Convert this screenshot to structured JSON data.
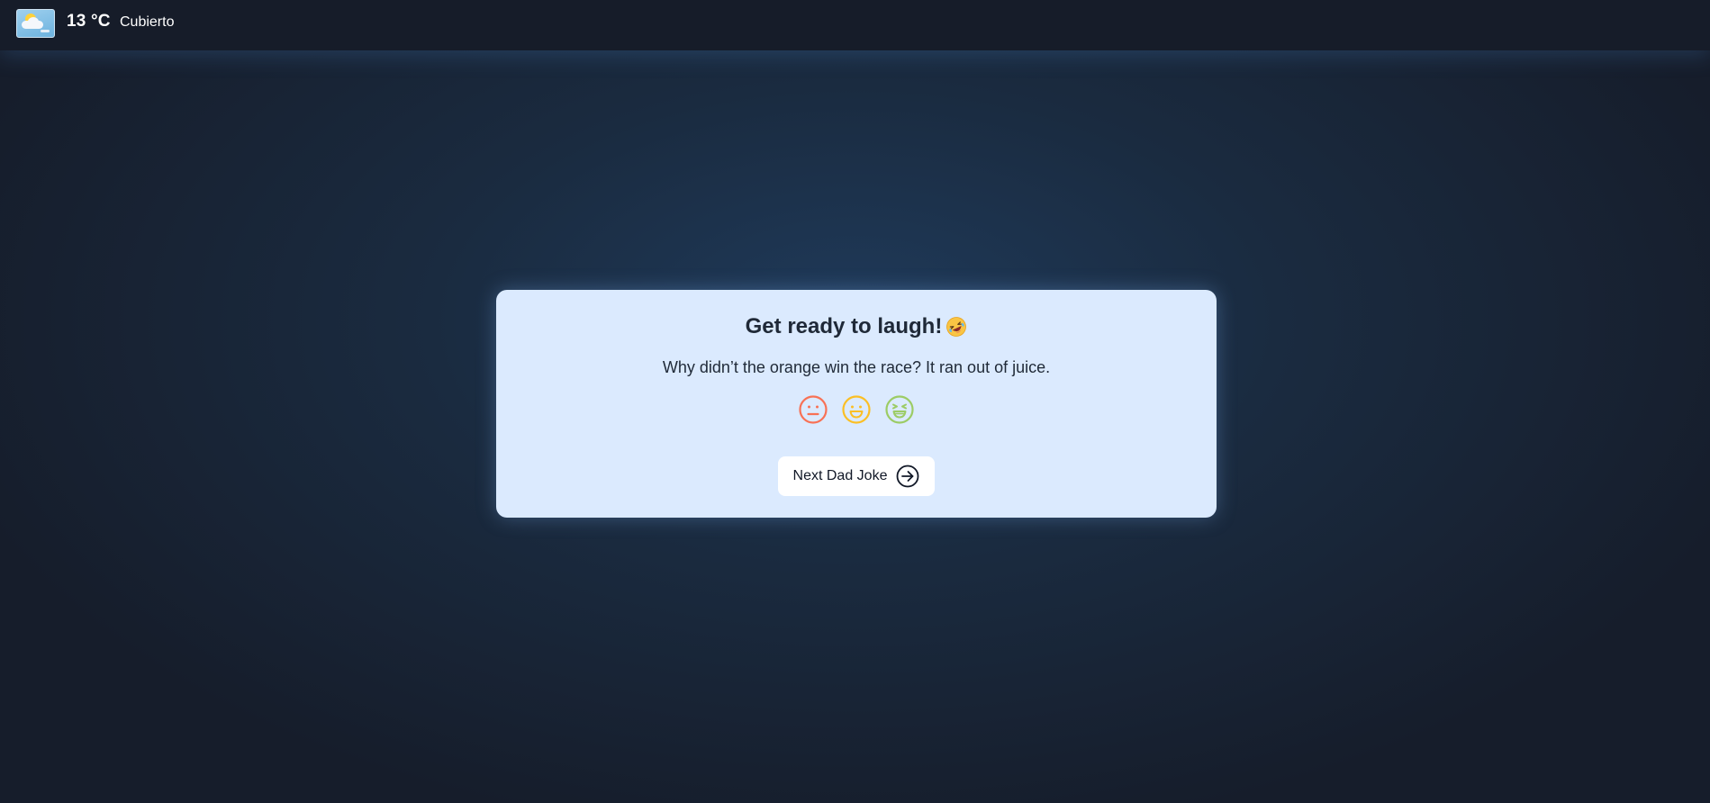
{
  "weather": {
    "icon": "partly-cloudy-icon",
    "temperature": "13 °C",
    "condition": "Cubierto"
  },
  "card": {
    "title": "Get ready to laugh!",
    "title_icon": "rolling-on-floor-laughing-icon",
    "joke": "Why didn’t the orange win the race? It ran out of juice.",
    "ratings": [
      {
        "icon": "neutral-face-icon",
        "color": "#f87155"
      },
      {
        "icon": "smiling-face-icon",
        "color": "#fbbf24"
      },
      {
        "icon": "laughing-face-icon",
        "color": "#9ccc65"
      }
    ],
    "next_button": {
      "label": "Next Dad Joke",
      "icon": "arrow-circle-right-icon"
    }
  }
}
